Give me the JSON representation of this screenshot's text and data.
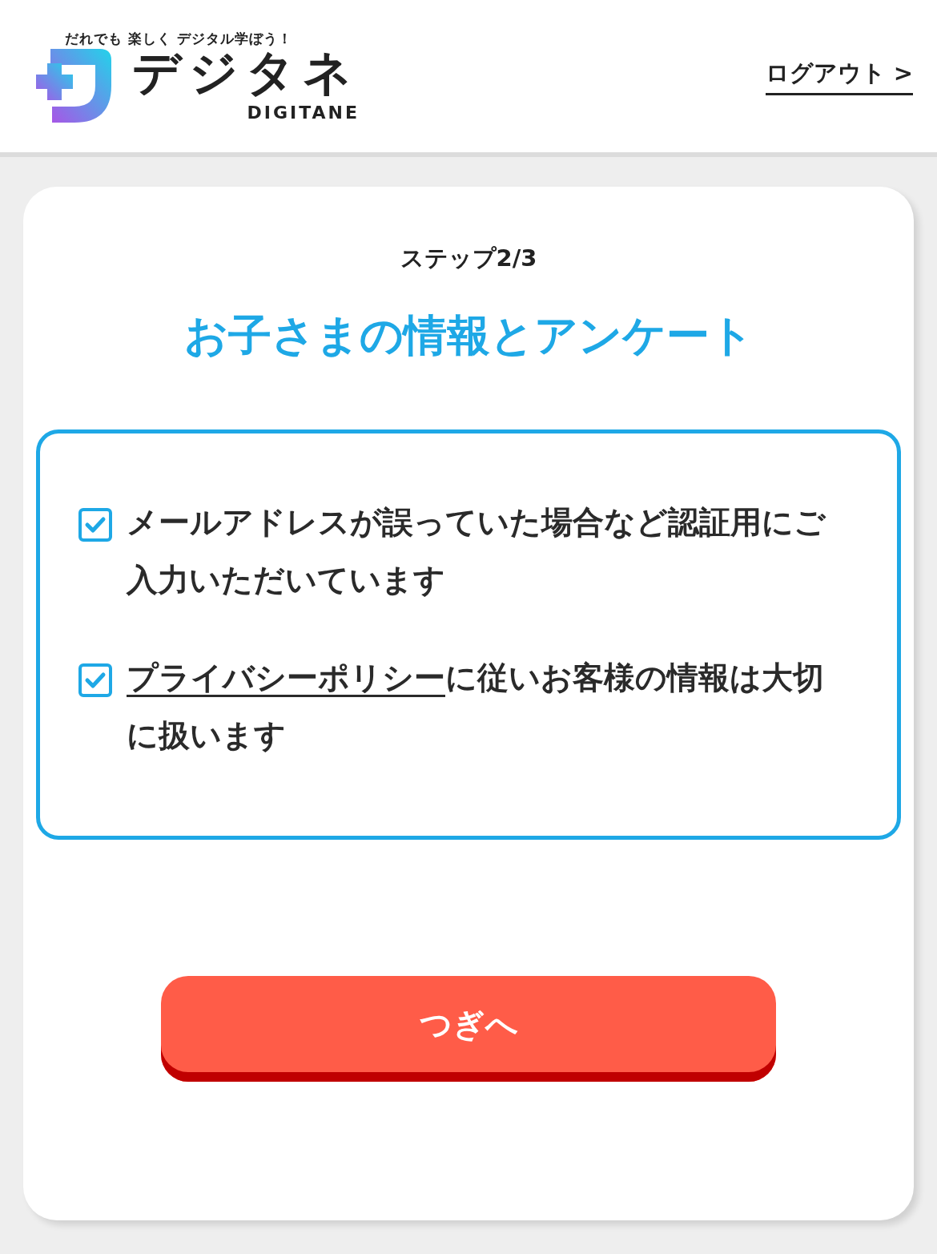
{
  "header": {
    "tagline": "だれでも 楽しく デジタル学ぼう！",
    "logo_text": "デジタネ",
    "logo_subtext": "DIGITANE",
    "logout": "ログアウト >"
  },
  "step": "ステップ2/3",
  "title": "お子さまの情報とアンケート",
  "consents": [
    {
      "checked": true,
      "text": "メールアドレスが誤っていた場合など認証用にご入力いただいています"
    },
    {
      "checked": true,
      "link": "プライバシーポリシー",
      "text": "に従いお客様の情報は大切に扱います"
    }
  ],
  "next_button": "つぎへ"
}
